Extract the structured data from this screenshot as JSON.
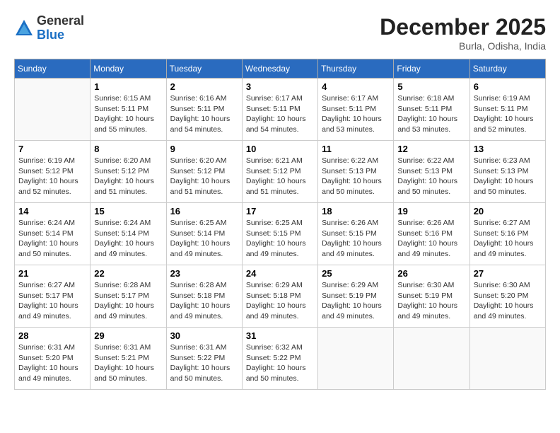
{
  "logo": {
    "general": "General",
    "blue": "Blue"
  },
  "header": {
    "month": "December 2025",
    "location": "Burla, Odisha, India"
  },
  "days_of_week": [
    "Sunday",
    "Monday",
    "Tuesday",
    "Wednesday",
    "Thursday",
    "Friday",
    "Saturday"
  ],
  "weeks": [
    [
      {
        "day": null,
        "info": null
      },
      {
        "day": "1",
        "sunrise": "6:15 AM",
        "sunset": "5:11 PM",
        "daylight": "10 hours and 55 minutes."
      },
      {
        "day": "2",
        "sunrise": "6:16 AM",
        "sunset": "5:11 PM",
        "daylight": "10 hours and 54 minutes."
      },
      {
        "day": "3",
        "sunrise": "6:17 AM",
        "sunset": "5:11 PM",
        "daylight": "10 hours and 54 minutes."
      },
      {
        "day": "4",
        "sunrise": "6:17 AM",
        "sunset": "5:11 PM",
        "daylight": "10 hours and 53 minutes."
      },
      {
        "day": "5",
        "sunrise": "6:18 AM",
        "sunset": "5:11 PM",
        "daylight": "10 hours and 53 minutes."
      },
      {
        "day": "6",
        "sunrise": "6:19 AM",
        "sunset": "5:11 PM",
        "daylight": "10 hours and 52 minutes."
      }
    ],
    [
      {
        "day": "7",
        "sunrise": "6:19 AM",
        "sunset": "5:12 PM",
        "daylight": "10 hours and 52 minutes."
      },
      {
        "day": "8",
        "sunrise": "6:20 AM",
        "sunset": "5:12 PM",
        "daylight": "10 hours and 51 minutes."
      },
      {
        "day": "9",
        "sunrise": "6:20 AM",
        "sunset": "5:12 PM",
        "daylight": "10 hours and 51 minutes."
      },
      {
        "day": "10",
        "sunrise": "6:21 AM",
        "sunset": "5:12 PM",
        "daylight": "10 hours and 51 minutes."
      },
      {
        "day": "11",
        "sunrise": "6:22 AM",
        "sunset": "5:13 PM",
        "daylight": "10 hours and 50 minutes."
      },
      {
        "day": "12",
        "sunrise": "6:22 AM",
        "sunset": "5:13 PM",
        "daylight": "10 hours and 50 minutes."
      },
      {
        "day": "13",
        "sunrise": "6:23 AM",
        "sunset": "5:13 PM",
        "daylight": "10 hours and 50 minutes."
      }
    ],
    [
      {
        "day": "14",
        "sunrise": "6:24 AM",
        "sunset": "5:14 PM",
        "daylight": "10 hours and 50 minutes."
      },
      {
        "day": "15",
        "sunrise": "6:24 AM",
        "sunset": "5:14 PM",
        "daylight": "10 hours and 49 minutes."
      },
      {
        "day": "16",
        "sunrise": "6:25 AM",
        "sunset": "5:14 PM",
        "daylight": "10 hours and 49 minutes."
      },
      {
        "day": "17",
        "sunrise": "6:25 AM",
        "sunset": "5:15 PM",
        "daylight": "10 hours and 49 minutes."
      },
      {
        "day": "18",
        "sunrise": "6:26 AM",
        "sunset": "5:15 PM",
        "daylight": "10 hours and 49 minutes."
      },
      {
        "day": "19",
        "sunrise": "6:26 AM",
        "sunset": "5:16 PM",
        "daylight": "10 hours and 49 minutes."
      },
      {
        "day": "20",
        "sunrise": "6:27 AM",
        "sunset": "5:16 PM",
        "daylight": "10 hours and 49 minutes."
      }
    ],
    [
      {
        "day": "21",
        "sunrise": "6:27 AM",
        "sunset": "5:17 PM",
        "daylight": "10 hours and 49 minutes."
      },
      {
        "day": "22",
        "sunrise": "6:28 AM",
        "sunset": "5:17 PM",
        "daylight": "10 hours and 49 minutes."
      },
      {
        "day": "23",
        "sunrise": "6:28 AM",
        "sunset": "5:18 PM",
        "daylight": "10 hours and 49 minutes."
      },
      {
        "day": "24",
        "sunrise": "6:29 AM",
        "sunset": "5:18 PM",
        "daylight": "10 hours and 49 minutes."
      },
      {
        "day": "25",
        "sunrise": "6:29 AM",
        "sunset": "5:19 PM",
        "daylight": "10 hours and 49 minutes."
      },
      {
        "day": "26",
        "sunrise": "6:30 AM",
        "sunset": "5:19 PM",
        "daylight": "10 hours and 49 minutes."
      },
      {
        "day": "27",
        "sunrise": "6:30 AM",
        "sunset": "5:20 PM",
        "daylight": "10 hours and 49 minutes."
      }
    ],
    [
      {
        "day": "28",
        "sunrise": "6:31 AM",
        "sunset": "5:20 PM",
        "daylight": "10 hours and 49 minutes."
      },
      {
        "day": "29",
        "sunrise": "6:31 AM",
        "sunset": "5:21 PM",
        "daylight": "10 hours and 50 minutes."
      },
      {
        "day": "30",
        "sunrise": "6:31 AM",
        "sunset": "5:22 PM",
        "daylight": "10 hours and 50 minutes."
      },
      {
        "day": "31",
        "sunrise": "6:32 AM",
        "sunset": "5:22 PM",
        "daylight": "10 hours and 50 minutes."
      },
      {
        "day": null,
        "info": null
      },
      {
        "day": null,
        "info": null
      },
      {
        "day": null,
        "info": null
      }
    ]
  ]
}
